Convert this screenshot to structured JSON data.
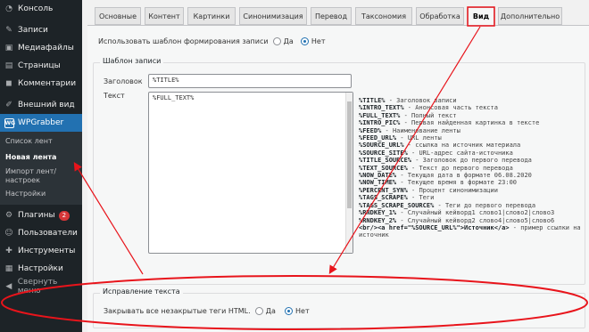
{
  "sidebar": {
    "items": [
      {
        "label": "Консоль",
        "icon": "dashboard-icon",
        "glyph": "◔"
      },
      {
        "label": "Записи",
        "icon": "pushpin-icon",
        "glyph": "✎"
      },
      {
        "label": "Медиафайлы",
        "icon": "media-icon",
        "glyph": "▣"
      },
      {
        "label": "Страницы",
        "icon": "page-icon",
        "glyph": "▤"
      },
      {
        "label": "Комментарии",
        "icon": "comment-icon",
        "glyph": "◼"
      },
      {
        "label": "Внешний вид",
        "icon": "appearance-icon",
        "glyph": "✐"
      },
      {
        "label": "WPGrabber",
        "icon": "wpgrabber-icon",
        "glyph": "WG"
      },
      {
        "label": "Плагины",
        "icon": "plugin-icon",
        "glyph": "⚙",
        "badge": "2"
      },
      {
        "label": "Пользователи",
        "icon": "users-icon",
        "glyph": "☺"
      },
      {
        "label": "Инструменты",
        "icon": "tools-icon",
        "glyph": "✚"
      },
      {
        "label": "Настройки",
        "icon": "settings-icon",
        "glyph": "▦"
      },
      {
        "label": "Свернуть меню",
        "icon": "collapse-icon",
        "glyph": "◀"
      }
    ],
    "submenu": [
      {
        "label": "Список лент"
      },
      {
        "label": "Новая лента"
      },
      {
        "label": "Импорт лент/ настроек"
      },
      {
        "label": "Настройки"
      }
    ]
  },
  "tabs": [
    "Основные",
    "Контент",
    "Картинки",
    "Синонимизация",
    "Перевод",
    "Таксономия",
    "Обработка",
    "Вид",
    "Дополнительно"
  ],
  "template_option": {
    "label": "Использовать шаблон формирования записи",
    "yes": "Да",
    "no": "Нет",
    "selected": "Нет"
  },
  "template_section": {
    "legend": "Шаблон записи",
    "title_label": "Заголовок",
    "title_value": "%TITLE%",
    "text_label": "Текст",
    "text_value": "%FULL_TEXT%"
  },
  "help": [
    {
      "tag": "%TITLE%",
      "desc": " - Заголовок записи"
    },
    {
      "tag": "%INTRO_TEXT%",
      "desc": " - Анонсовая часть текста"
    },
    {
      "tag": "%FULL_TEXT%",
      "desc": " - Полный текст"
    },
    {
      "tag": "%INTRO_PIC%",
      "desc": " - Первая найденная картинка в тексте"
    },
    {
      "tag": "%FEED%",
      "desc": " - Наименование ленты"
    },
    {
      "tag": "%FEED_URL%",
      "desc": " - URL ленты"
    },
    {
      "tag": "%SOURCE_URL%",
      "desc": " - ссылка на источник материала"
    },
    {
      "tag": "%SOURCE_SITE%",
      "desc": " - URL-адрес сайта-источника"
    },
    {
      "tag": "%TITLE_SOURCE%",
      "desc": " - Заголовок до первого перевода"
    },
    {
      "tag": "%TEXT_SOURCE%",
      "desc": " - Текст до первого перевода"
    },
    {
      "tag": "%NOW_DATE%",
      "desc": " - Текущая дата в формате 06.08.2020"
    },
    {
      "tag": "%NOW_TIME%",
      "desc": " - Текущее время в формате 23:00"
    },
    {
      "tag": "%PERCENT_SYN%",
      "desc": " - Процент синонимизации"
    },
    {
      "tag": "%TAGS_SCRAPE%",
      "desc": " - Теги"
    },
    {
      "tag": "%TAGS_SCRAPE_SOURCE%",
      "desc": " - Теги до первого перевода"
    },
    {
      "tag": "%RNDKEY_1%",
      "desc": " - Случайный кейворд1 слово1|слово2|слово3"
    },
    {
      "tag": "%RNDKEY_2%",
      "desc": " - Случайный кейворд2 слово4|слово5|слово6"
    },
    {
      "tag": "<br/><a href=\"%SOURCE_URL%\">Источник</a>",
      "desc": " - пример ссылки на"
    },
    {
      "tag": "",
      "desc": "источник"
    }
  ],
  "fix_section": {
    "legend": "Исправление текста",
    "label": "Закрывать все незакрытые теги HTML.",
    "yes": "Да",
    "no": "Нет",
    "selected": "Нет"
  },
  "colors": {
    "sidebar": "#1d2327",
    "accent": "#2271b1",
    "annotation": "#e8141b"
  }
}
